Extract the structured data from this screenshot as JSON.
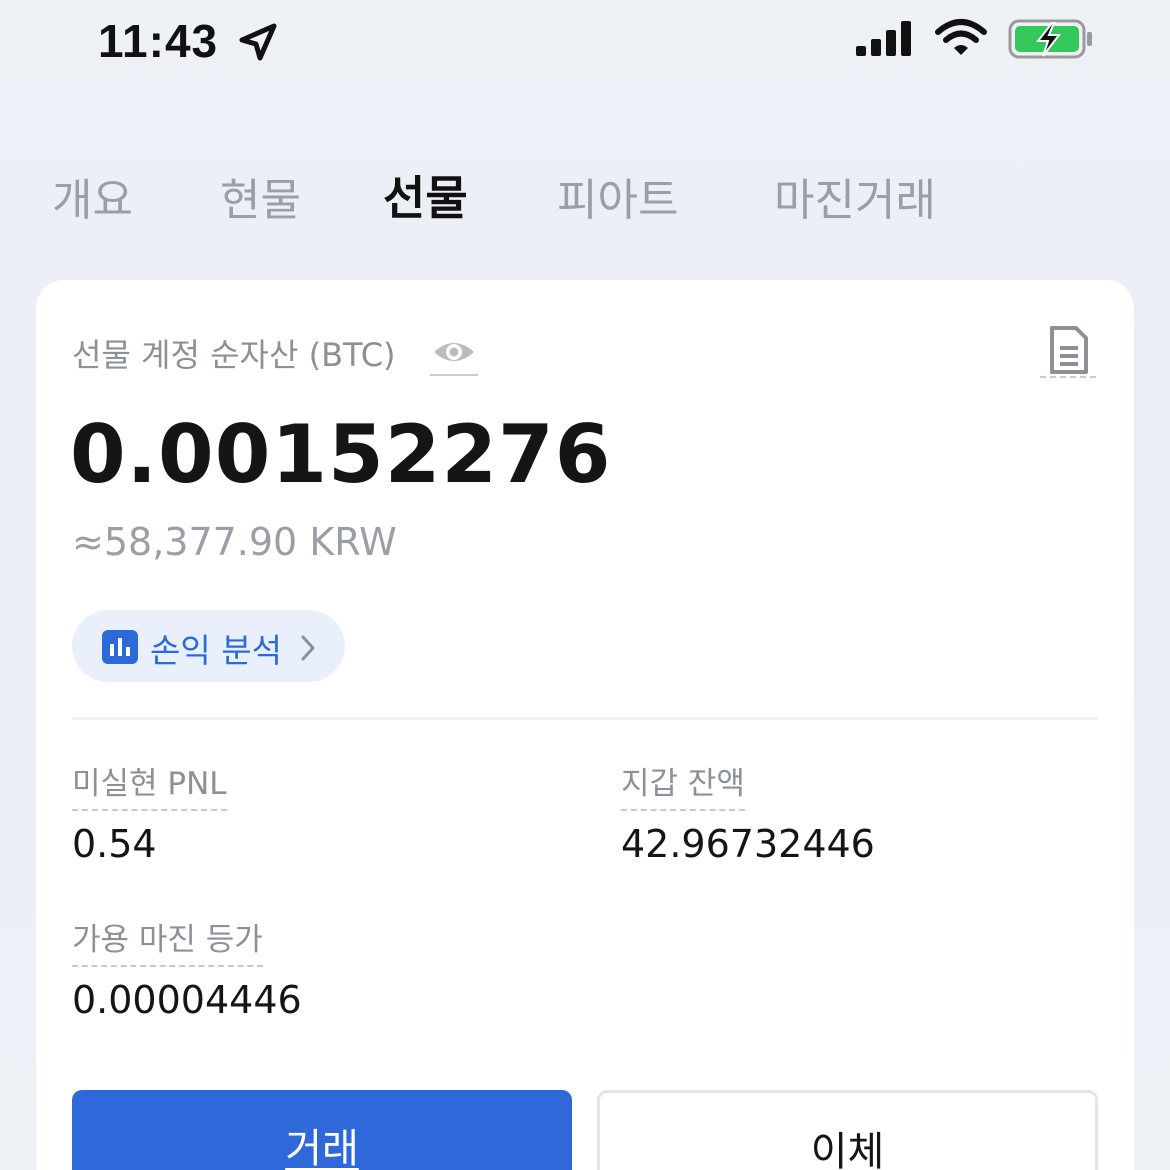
{
  "status_bar": {
    "time": "11:43",
    "icons": [
      "location-arrow-icon",
      "cellular-signal-icon",
      "wifi-icon",
      "battery-charging-icon"
    ],
    "battery_color": "#34c759"
  },
  "tabs": [
    {
      "label": "개요",
      "active": false
    },
    {
      "label": "현물",
      "active": false
    },
    {
      "label": "선물",
      "active": true
    },
    {
      "label": "피아트",
      "active": false
    },
    {
      "label": "마진거래",
      "active": false
    }
  ],
  "account": {
    "label": "선물 계정 순자산 (BTC)",
    "amount": "0.00152276",
    "krw_equiv": "≈58,377.90 KRW",
    "pnl_analysis_label": "손익 분석"
  },
  "stats": {
    "unrealized_pnl_label": "미실현 PNL",
    "unrealized_pnl_value": "0.54",
    "wallet_balance_label": "지갑 잔액",
    "wallet_balance_value": "42.96732446",
    "available_margin_label": "가용 마진 등가",
    "available_margin_value": "0.00004446"
  },
  "actions": {
    "trade_label": "거래",
    "transfer_label": "이체"
  },
  "colors": {
    "accent": "#2f68d8",
    "pill_bg": "#eaf0fb",
    "muted_text": "#8c9097"
  }
}
